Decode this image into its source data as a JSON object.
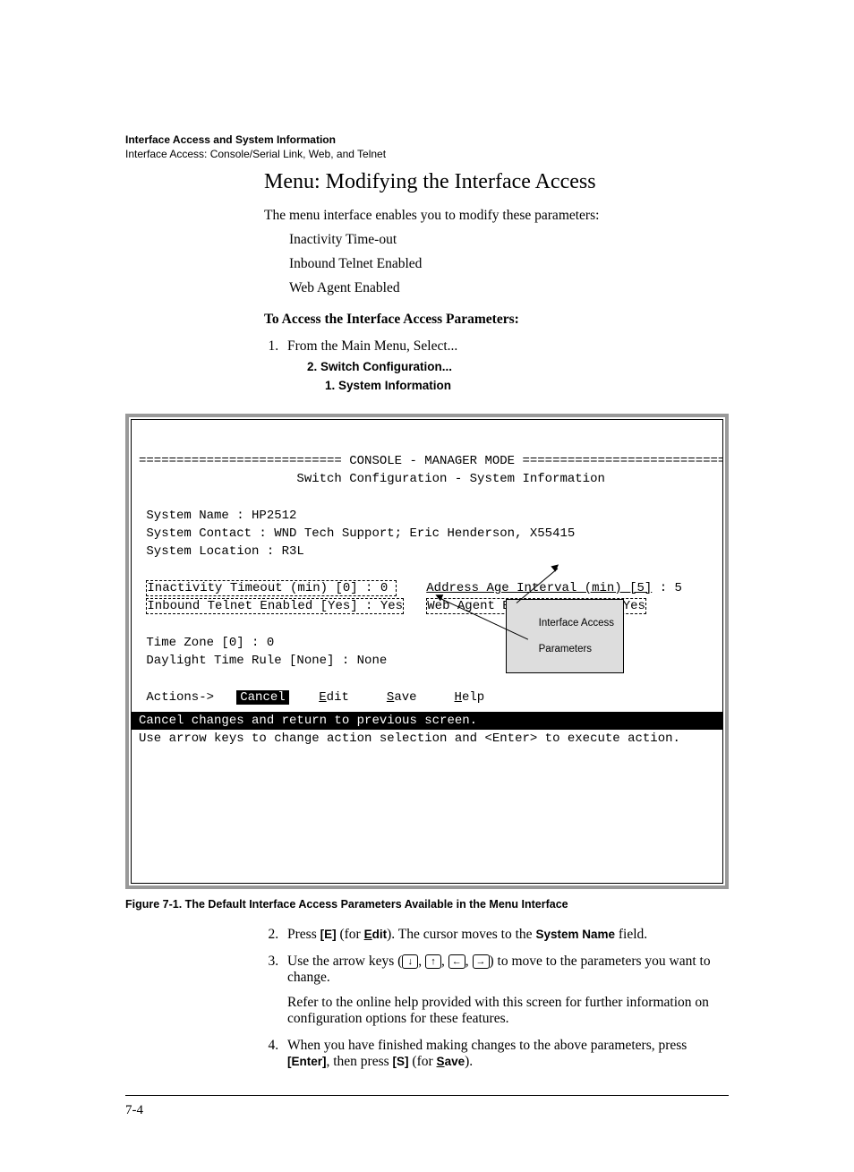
{
  "running_head": {
    "title": "Interface Access and System Information",
    "subtitle": "Interface Access: Console/Serial Link, Web, and Telnet"
  },
  "heading": "Menu: Modifying the Interface Access",
  "intro": "The menu interface enables you to modify these parameters:",
  "params": [
    "Inactivity Time-out",
    "Inbound Telnet Enabled",
    "Web Agent Enabled"
  ],
  "access_heading": "To Access the Interface Access Parameters:",
  "step1": {
    "lead": "From the Main Menu, Select...",
    "sub1": "2. Switch Configuration...",
    "sub2": "1. System Information"
  },
  "terminal": {
    "header_line": "=========================== CONSOLE - MANAGER MODE =============================",
    "subtitle": "                     Switch Configuration - System Information",
    "sys_name": " System Name : HP2512",
    "sys_contact": " System Contact : WND Tech Support; Eric Henderson, X55415",
    "sys_location": " System Location : R3L",
    "inactivity": "Inactivity Timeout (min) [0] : 0 ",
    "addr_age": "Address Age Interval (min) [5]",
    "addr_age_val": " : 5",
    "inbound": "Inbound Telnet Enabled [Yes] : Yes",
    "webagent": "Web Agent Enabled [Yes] : Yes",
    "timezone": " Time Zone [0] : 0",
    "daylight": " Daylight Time Rule [None] : None",
    "actions_lbl": " Actions->",
    "cancel": "Cancel",
    "edit": "Edit",
    "save": "Save",
    "help": "Help",
    "status": "Cancel changes and return to previous screen.",
    "hint": "Use arrow keys to change action selection and <Enter> to execute action."
  },
  "callout": {
    "l1": "Interface Access",
    "l2": "Parameters"
  },
  "figure_caption": "Figure 7-1.  The Default Interface Access Parameters Available in the Menu Interface",
  "step2": {
    "pre": "Press ",
    "key": "[E]",
    "mid": " (for ",
    "edit_u": "E",
    "edit_rest": "dit",
    "post1": "). The cursor moves to the ",
    "sysname": "System Name",
    "post2": " field."
  },
  "step3": {
    "pre": "Use the arrow keys (",
    "k_down": "↓",
    "sep": ", ",
    "k_up": "↑",
    "k_left": "←",
    "k_right": "→",
    "post": ") to move to the parameters you want to change.",
    "para": "Refer to the online help provided with this screen for further information on configuration options for these features."
  },
  "step4": {
    "pre": "When you have finished making changes to the above parameters, press ",
    "enter": "[Enter]",
    "mid": ", then press ",
    "s": "[S]",
    "mid2": " (for ",
    "save_u": "S",
    "save_rest": "ave",
    "post": ")."
  },
  "page_number": "7-4"
}
